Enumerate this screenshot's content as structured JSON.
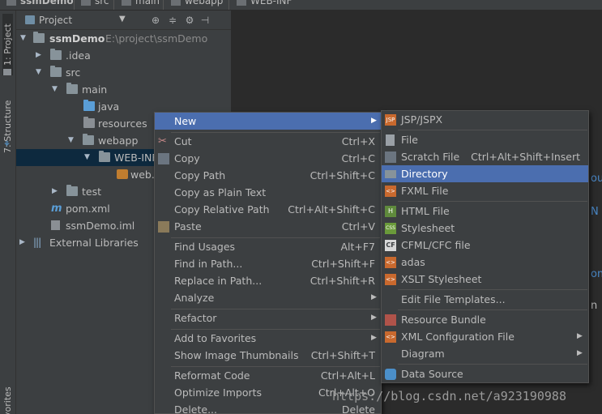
{
  "breadcrumb": [
    {
      "label": "ssmDemo"
    },
    {
      "label": "src"
    },
    {
      "label": "main"
    },
    {
      "label": "webapp"
    },
    {
      "label": "WEB-INF"
    }
  ],
  "tool_window_tabs": {
    "project": "1: Project",
    "structure": "7: Structure",
    "favorites": "vorites"
  },
  "panel": {
    "title": "Project",
    "view_dropdown": "▼",
    "icons": [
      "target-icon",
      "collapse-icon",
      "settings-icon",
      "hide-icon"
    ]
  },
  "tree": [
    {
      "label": "ssmDemo",
      "path": "E:\\project\\ssmDemo"
    },
    {
      "label": ".idea"
    },
    {
      "label": "src"
    },
    {
      "label": "main"
    },
    {
      "label": "java"
    },
    {
      "label": "resources"
    },
    {
      "label": "webapp"
    },
    {
      "label": "WEB-INF"
    },
    {
      "label": "web.x"
    },
    {
      "label": "test"
    },
    {
      "label": "pom.xml"
    },
    {
      "label": "ssmDemo.iml"
    },
    {
      "label": "External Libraries"
    }
  ],
  "context_menu": [
    {
      "label": "New",
      "shortcut": "",
      "submenu": true,
      "highlighted": true
    },
    {
      "label": "Cut",
      "shortcut": "Ctrl+X"
    },
    {
      "label": "Copy",
      "shortcut": "Ctrl+C"
    },
    {
      "label": "Copy Path",
      "shortcut": "Ctrl+Shift+C"
    },
    {
      "label": "Copy as Plain Text",
      "shortcut": ""
    },
    {
      "label": "Copy Relative Path",
      "shortcut": "Ctrl+Alt+Shift+C"
    },
    {
      "label": "Paste",
      "shortcut": "Ctrl+V"
    },
    {
      "label": "Find Usages",
      "shortcut": "Alt+F7"
    },
    {
      "label": "Find in Path...",
      "shortcut": "Ctrl+Shift+F"
    },
    {
      "label": "Replace in Path...",
      "shortcut": "Ctrl+Shift+R"
    },
    {
      "label": "Analyze",
      "shortcut": "",
      "submenu": true
    },
    {
      "label": "Refactor",
      "shortcut": "",
      "submenu": true
    },
    {
      "label": "Add to Favorites",
      "shortcut": "",
      "submenu": true
    },
    {
      "label": "Show Image Thumbnails",
      "shortcut": "Ctrl+Shift+T"
    },
    {
      "label": "Reformat Code",
      "shortcut": "Ctrl+Alt+L"
    },
    {
      "label": "Optimize Imports",
      "shortcut": "Ctrl+Alt+O"
    },
    {
      "label": "Delete...",
      "shortcut": "Delete"
    }
  ],
  "new_submenu": [
    {
      "label": "JSP/JSPX",
      "icon": "JSP"
    },
    {
      "label": "File",
      "icon": "file"
    },
    {
      "label": "Scratch File",
      "shortcut": "Ctrl+Alt+Shift+Insert",
      "icon": "scratch"
    },
    {
      "label": "Directory",
      "highlighted": true,
      "icon": "folder"
    },
    {
      "label": "FXML File",
      "icon": "fxml"
    },
    {
      "label": "HTML File",
      "icon": "H"
    },
    {
      "label": "Stylesheet",
      "icon": "CSS"
    },
    {
      "label": "CFML/CFC file",
      "icon": "CF"
    },
    {
      "label": "adas",
      "icon": "tpl"
    },
    {
      "label": "XSLT Stylesheet",
      "icon": "tpl"
    },
    {
      "label": "Edit File Templates...",
      "icon": ""
    },
    {
      "label": "Resource Bundle",
      "icon": "bundle"
    },
    {
      "label": "XML Configuration File",
      "submenu": true,
      "icon": "tpl"
    },
    {
      "label": "Diagram",
      "submenu": true,
      "icon": ""
    },
    {
      "label": "Data Source",
      "icon": "db"
    }
  ],
  "editor_fragments": [
    "oul",
    "N",
    "om",
    "n"
  ],
  "watermark": "https://blog.csdn.net/a923190988",
  "colors": {
    "background": "#2b2b2b",
    "panel": "#3c3f41",
    "selection": "#0d293e",
    "menu_highlight": "#4b6eaf",
    "text": "#bbbbbb"
  }
}
